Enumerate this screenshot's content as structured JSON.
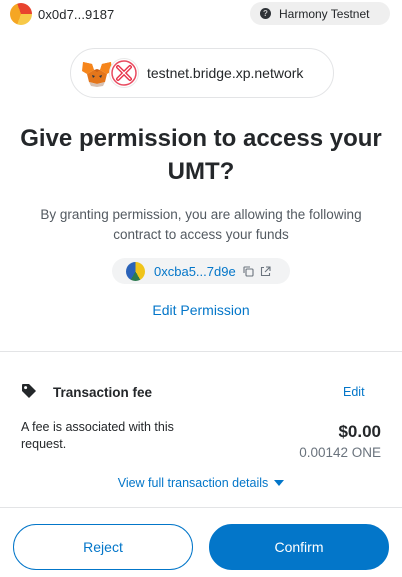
{
  "header": {
    "account_address": "0x0d7...9187",
    "network_label": "Harmony Testnet",
    "network_icon_glyph": "?"
  },
  "origin": {
    "site": "testnet.bridge.xp.network"
  },
  "title": {
    "line1": "Give permission to access your",
    "line2": "UMT?"
  },
  "description": "By granting permission, you are allowing the following contract to access your funds",
  "contract": {
    "address": "0xcba5...7d9e"
  },
  "edit_permission_label": "Edit Permission",
  "fee": {
    "title": "Transaction fee",
    "edit_label": "Edit",
    "note": "A fee is associated with this request.",
    "fiat_amount": "$0.00",
    "native_amount": "0.00142 ONE",
    "view_details_label": "View full transaction details"
  },
  "actions": {
    "reject_label": "Reject",
    "confirm_label": "Confirm"
  },
  "colors": {
    "primary": "#0376c9",
    "text": "#24272a",
    "muted": "#535a61",
    "border": "#e3e4e6"
  }
}
